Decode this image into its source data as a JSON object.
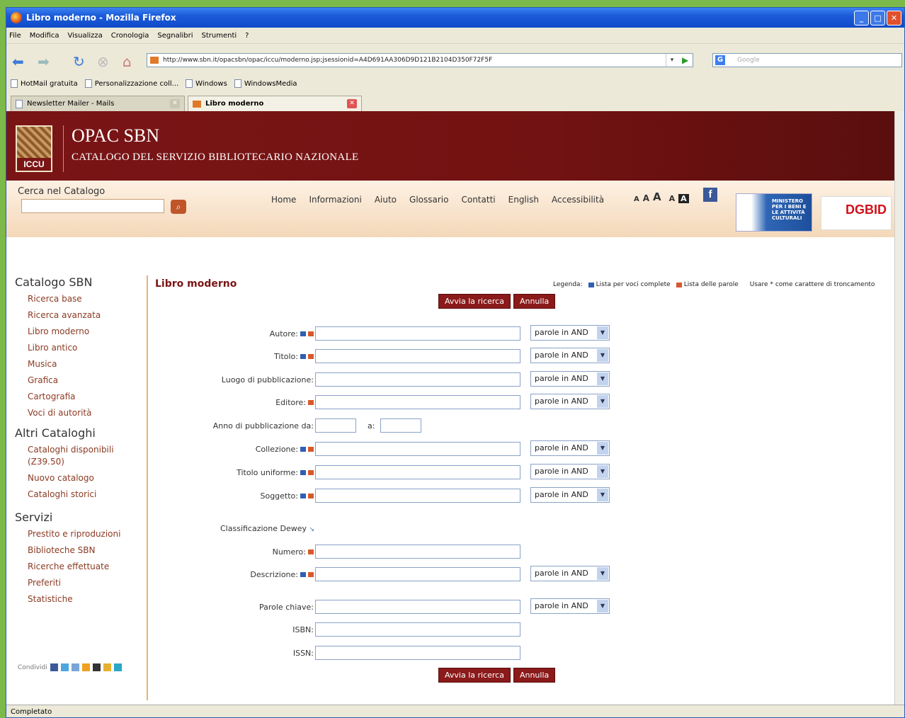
{
  "window": {
    "title": "Libro moderno - Mozilla Firefox"
  },
  "menu": [
    "File",
    "Modifica",
    "Visualizza",
    "Cronologia",
    "Segnalibri",
    "Strumenti",
    "?"
  ],
  "url": "http://www.sbn.it/opacsbn/opac/iccu/moderno.jsp;jsessionid=A4D691AA306D9D121B2104D350F72F5F",
  "search_placeholder": "Google",
  "bookmarks": [
    "HotMail gratuita",
    "Personalizzazione coll...",
    "Windows",
    "WindowsMedia"
  ],
  "tabs": [
    "Newsletter Mailer - Mails",
    "Libro moderno"
  ],
  "header": {
    "logo_text": "ICCU",
    "title": "OPAC SBN",
    "subtitle": "CATALOGO DEL SERVIZIO BIBLIOTECARIO NAZIONALE"
  },
  "search": {
    "label": "Cerca nel Catalogo"
  },
  "topnav": [
    "Home",
    "Informazioni",
    "Aiuto",
    "Glossario",
    "Contatti",
    "English",
    "Accessibilità"
  ],
  "font_sizes": [
    "A",
    "A",
    "A",
    "A",
    "A"
  ],
  "facebook": "f",
  "mibac_text": [
    "MINISTERO",
    "PER I BENI E",
    "LE ATTIVITÀ",
    "CULTURALI"
  ],
  "dgbid_text": "DGBID",
  "sidebar": {
    "groups": [
      {
        "title": "Catalogo SBN",
        "items": [
          "Ricerca base",
          "Ricerca avanzata",
          "Libro moderno",
          "Libro antico",
          "Musica",
          "Grafica",
          "Cartografia",
          "Voci di autorità"
        ]
      },
      {
        "title": "Altri Cataloghi",
        "items": [
          "Cataloghi disponibili (Z39.50)",
          "Nuovo catalogo",
          "Cataloghi storici"
        ]
      },
      {
        "title": "Servizi",
        "items": [
          "Prestito e riproduzioni",
          "Biblioteche SBN",
          "Ricerche effettuate",
          "Preferiti",
          "Statistiche"
        ]
      }
    ],
    "share_label": "Condividi"
  },
  "main": {
    "title": "Libro moderno",
    "legend_label": "Legenda:",
    "legend_blue": "Lista per voci complete",
    "legend_orange": "Lista delle parole",
    "truncation_hint": "Usare * come carattere di troncamento",
    "search_button": "Avvia la ricerca",
    "cancel_button": "Annulla",
    "select_value": "parole in AND",
    "fields": {
      "autore": "Autore:",
      "titolo": "Titolo:",
      "luogo": "Luogo di pubblicazione:",
      "editore": "Editore:",
      "anno_da": "Anno di pubblicazione da:",
      "anno_a": "a:",
      "collezione": "Collezione:",
      "titolo_uniforme": "Titolo uniforme:",
      "soggetto": "Soggetto:",
      "dewey": "Classificazione Dewey",
      "numero": "Numero:",
      "descrizione": "Descrizione:",
      "parole_chiave": "Parole chiave:",
      "isbn": "ISBN:",
      "issn": "ISSN:"
    }
  },
  "status": "Completato"
}
